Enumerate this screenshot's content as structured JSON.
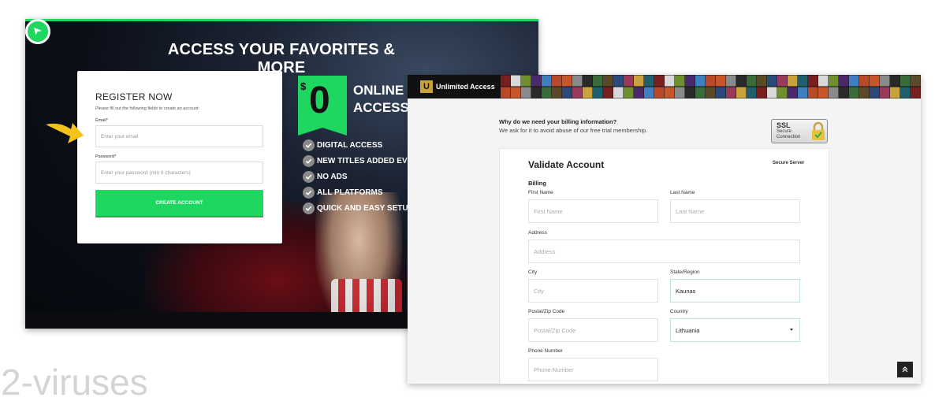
{
  "left_page": {
    "headline": "ACCESS YOUR FAVORITES & MORE",
    "register": {
      "title": "REGISTER NOW",
      "subtitle": "Please fill out the following fields to create an account:",
      "email_label": "Email*",
      "email_placeholder": "Enter your email",
      "password_label": "Password*",
      "password_placeholder": "Enter your password (min 6 characters)",
      "button_label": "CREATE ACCOUNT"
    },
    "price": {
      "currency": "$",
      "amount": "0"
    },
    "offer_line1": "ONLINE",
    "offer_line2": "ACCESS",
    "features": [
      "DIGITAL ACCESS",
      "NEW TITLES ADDED EVERY",
      "NO ADS",
      "ALL PLATFORMS",
      "QUICK AND EASY SETUP"
    ],
    "colors": {
      "accent": "#1ed760",
      "arrow": "#f3c21b"
    },
    "icons": {
      "logo": "play-icon",
      "feature": "check-icon",
      "pointer": "arrow-pointer-icon"
    }
  },
  "right_page": {
    "brand_letter": "U",
    "brand_name": "Unlimited Access",
    "billing_question": "Why do we need your billing information?",
    "billing_answer": "We ask for it to avoid abuse of our free trial membership.",
    "ssl": {
      "title": "SSL",
      "line1": "Secure",
      "line2": "Connection"
    },
    "form": {
      "title": "Validate Account",
      "secure_label": "Secure Server",
      "section": "Billing",
      "first_name": {
        "label": "First Name",
        "placeholder": "First Name"
      },
      "last_name": {
        "label": "Last Name",
        "placeholder": "Last Name"
      },
      "address": {
        "label": "Address",
        "placeholder": "Address"
      },
      "city": {
        "label": "City",
        "placeholder": "City"
      },
      "state": {
        "label": "State/Region",
        "value": "Kaunas"
      },
      "postal": {
        "label": "Postal/Zip Code",
        "placeholder": "Postal/Zip Code"
      },
      "country": {
        "label": "Country",
        "value": "Lithuania"
      },
      "phone": {
        "label": "Phone Number",
        "placeholder": "Phone Number"
      }
    },
    "icons": {
      "lock": "lock-icon",
      "scroll_top": "double-chevron-up-icon",
      "dropdown": "chevron-down-icon"
    }
  },
  "watermark": "2-viruses"
}
